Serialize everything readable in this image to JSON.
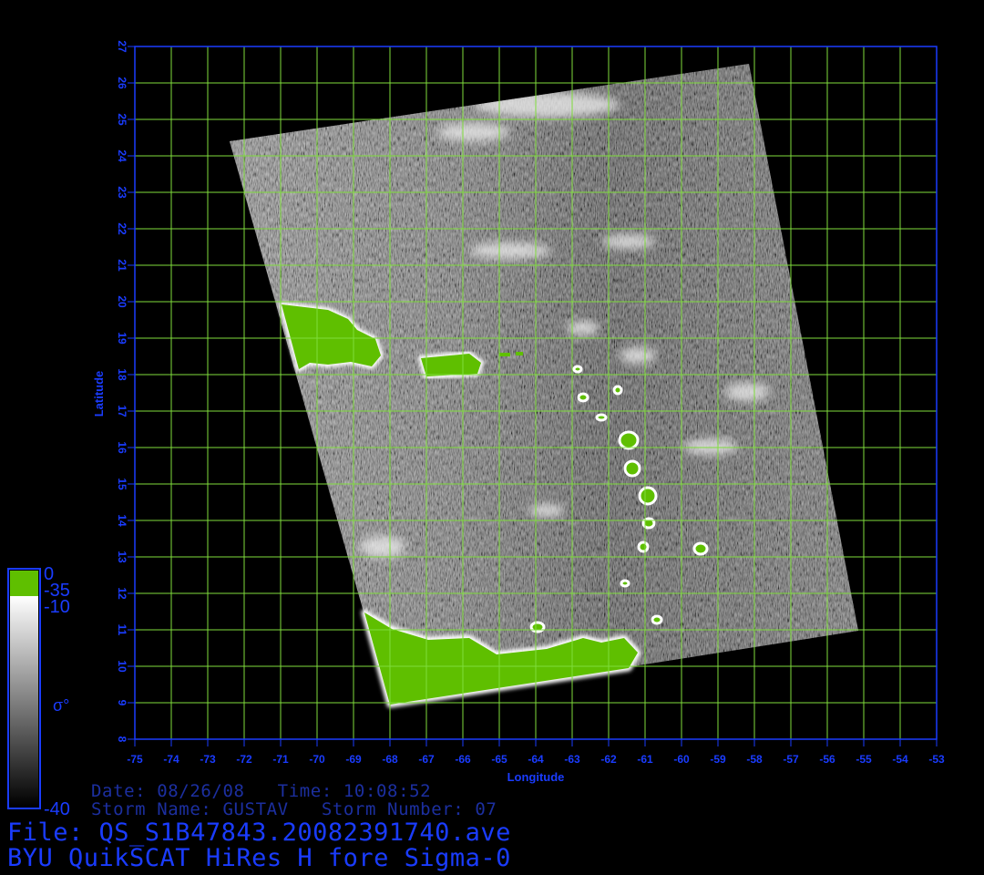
{
  "map": {
    "x_axis_label": "Longitude",
    "y_axis_label": "Latitude",
    "lon_ticks": [
      "-75",
      "-74",
      "-73",
      "-72",
      "-71",
      "-70",
      "-69",
      "-68",
      "-67",
      "-66",
      "-65",
      "-64",
      "-63",
      "-62",
      "-61",
      "-60",
      "-59",
      "-58",
      "-57",
      "-56",
      "-55",
      "-54",
      "-53"
    ],
    "lat_ticks": [
      "8",
      "9",
      "10",
      "11",
      "12",
      "13",
      "14",
      "15",
      "16",
      "17",
      "18",
      "19",
      "20",
      "21",
      "22",
      "23",
      "24",
      "25",
      "26",
      "27"
    ],
    "lon_range": [
      -75,
      -53
    ],
    "lat_range": [
      8,
      27
    ],
    "grid": true,
    "colors": {
      "axis": "#1a3cff",
      "grid": "#7fdc3c",
      "land": "#5fbf00",
      "background": "#000000"
    }
  },
  "colorbar": {
    "labels": {
      "top": "0",
      "land": "-35",
      "upper": "-10",
      "symbol": "σ°",
      "bottom": "-40"
    },
    "colors": {
      "land": "#5fbf00",
      "frame": "#1a3cff"
    }
  },
  "info": {
    "date_time": "Date: 08/26/08   Time: 10:08:52",
    "storm": "Storm Name: GUSTAV   Storm Number: 07",
    "file": "File: QS_S1B47843.20082391740.ave",
    "product": "BYU QuikSCAT HiRes H fore Sigma-0"
  }
}
